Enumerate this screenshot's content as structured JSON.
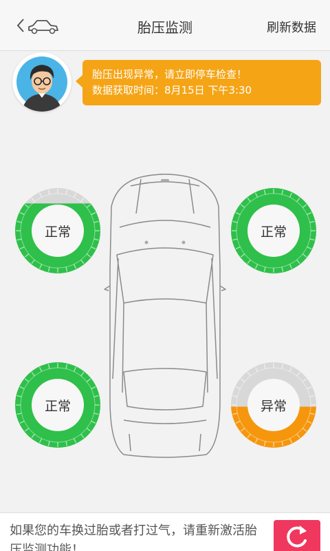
{
  "header": {
    "title": "胎压监测",
    "refresh_label": "刷新数据"
  },
  "message": {
    "line1": "胎压出现异常，请立即停车检查！",
    "line2": "数据获取时间：8月15日 下午3:30"
  },
  "tires": {
    "front_left": {
      "status": "正常",
      "fill_level": 0.82,
      "color": "#2ec04a"
    },
    "front_right": {
      "status": "正常",
      "fill_level": 1.0,
      "color": "#2ec04a"
    },
    "rear_left": {
      "status": "正常",
      "fill_level": 1.0,
      "color": "#2ec04a"
    },
    "rear_right": {
      "status": "异常",
      "fill_level": 0.48,
      "color": "#f5960c"
    }
  },
  "footer": {
    "text": "如果您的车换过胎或者打过气，请重新激活胎压监测功能！",
    "reset_icon": "refresh-icon"
  },
  "colors": {
    "normal": "#2ec04a",
    "abnormal": "#f5960c",
    "empty": "#d8d8d8",
    "accent": "#f5a416",
    "reset": "#f0375d"
  }
}
